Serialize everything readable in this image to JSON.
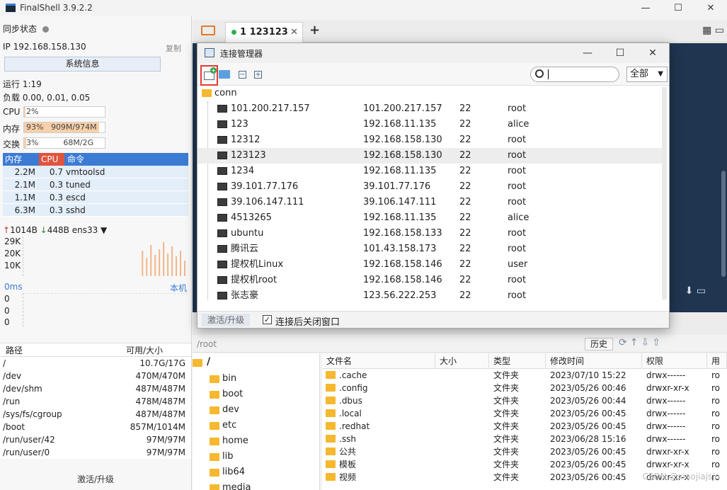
{
  "window": {
    "title": "FinalShell 3.9.2.2"
  },
  "left_panel": {
    "sync_label": "同步状态",
    "ip_label": "IP 192.168.158.130",
    "copy_label": "复制",
    "sysinfo_button": "系统信息",
    "uptime": "运行 1:19",
    "load": "负载 0.00, 0.01, 0.05",
    "cpu": {
      "label": "CPU",
      "text": "2%",
      "fraction": 0.02
    },
    "mem": {
      "label": "内存",
      "text": "93%   909M/974M",
      "fraction": 0.93
    },
    "swap": {
      "label": "交换",
      "text": "3%          68M/2G",
      "fraction": 0.03
    },
    "process_headers": [
      "内存",
      "CPU",
      "命令"
    ],
    "processes": [
      [
        "2.2M",
        "0.7",
        "vmtoolsd"
      ],
      [
        "2.1M",
        "0.3",
        "tuned"
      ],
      [
        "1.1M",
        "0.3",
        "escd"
      ],
      [
        "6.3M",
        "0.3",
        "sshd"
      ]
    ],
    "net_up": "1014B",
    "net_down": "448B",
    "net_iface": "ens33 ▼",
    "net_axis": [
      "29K",
      "20K",
      "10K"
    ],
    "latency_label": "0ms",
    "latency_local": "本机",
    "latency_axis": [
      "0",
      "0",
      "0"
    ],
    "disk_headers": [
      "路径",
      "可用/大小"
    ],
    "disks": [
      [
        "/",
        "10.7G/17G"
      ],
      [
        "/dev",
        "470M/470M"
      ],
      [
        "/dev/shm",
        "487M/487M"
      ],
      [
        "/run",
        "478M/487M"
      ],
      [
        "/sys/fs/cgroup",
        "487M/487M"
      ],
      [
        "/boot",
        "857M/1014M"
      ],
      [
        "/run/user/42",
        "97M/97M"
      ],
      [
        "/run/user/0",
        "97M/97M"
      ]
    ],
    "activate_button": "激活/升级"
  },
  "tabs": {
    "active_tab": "1 123123",
    "add": "+"
  },
  "filebar": {
    "path": "/root",
    "history_button": "历史"
  },
  "tree": {
    "root": "/",
    "items": [
      "bin",
      "boot",
      "dev",
      "etc",
      "home",
      "lib",
      "lib64",
      "media"
    ]
  },
  "files": {
    "headers": [
      "文件名",
      "大小",
      "类型",
      "修改时间",
      "权限",
      "用"
    ],
    "rows": [
      [
        ".cache",
        "",
        "文件夹",
        "2023/07/10 15:22",
        "drwx------",
        "ro"
      ],
      [
        ".config",
        "",
        "文件夹",
        "2023/05/26 00:46",
        "drwxr-xr-x",
        "ro"
      ],
      [
        ".dbus",
        "",
        "文件夹",
        "2023/05/26 00:44",
        "drwx------",
        "ro"
      ],
      [
        ".local",
        "",
        "文件夹",
        "2023/05/26 00:45",
        "drwx------",
        "ro"
      ],
      [
        ".redhat",
        "",
        "文件夹",
        "2023/05/26 00:45",
        "drwx------",
        "ro"
      ],
      [
        ".ssh",
        "",
        "文件夹",
        "2023/06/28 15:16",
        "drwx------",
        "ro"
      ],
      [
        "公共",
        "",
        "文件夹",
        "2023/05/26 00:45",
        "drwxr-xr-x",
        "ro"
      ],
      [
        "模板",
        "",
        "文件夹",
        "2023/05/26 00:45",
        "drwxr-xr-x",
        "ro"
      ],
      [
        "视频",
        "",
        "文件夹",
        "2023/05/26 00:45",
        "drwxr-xr-x",
        "ro"
      ]
    ]
  },
  "watermark": "CSDN @xiaojiajsjo",
  "modal": {
    "title": "连接管理器",
    "filter_value": "全部",
    "root_folder": "conn",
    "connections": [
      [
        "101.200.217.157",
        "101.200.217.157",
        "22",
        "root"
      ],
      [
        "123",
        "192.168.11.135",
        "22",
        "alice"
      ],
      [
        "12312",
        "192.168.158.130",
        "22",
        "root"
      ],
      [
        "123123",
        "192.168.158.130",
        "22",
        "root"
      ],
      [
        "1234",
        "192.168.11.135",
        "22",
        "root"
      ],
      [
        "39.101.77.176",
        "39.101.77.176",
        "22",
        "root"
      ],
      [
        "39.106.147.111",
        "39.106.147.111",
        "22",
        "root"
      ],
      [
        "4513265",
        "192.168.11.135",
        "22",
        "alice"
      ],
      [
        "ubuntu",
        "192.168.158.133",
        "22",
        "root"
      ],
      [
        "腾讯云",
        "101.43.158.173",
        "22",
        "root"
      ],
      [
        "提权机Linux",
        "192.168.158.146",
        "22",
        "user"
      ],
      [
        "提权机root",
        "192.168.158.146",
        "22",
        "root"
      ],
      [
        "张志豪",
        "123.56.222.253",
        "22",
        "root"
      ]
    ],
    "selected_index": 3,
    "upgrade_button": "激活/升级",
    "close_after_connect_label": "连接后关闭窗口",
    "close_after_connect_checked": true
  }
}
